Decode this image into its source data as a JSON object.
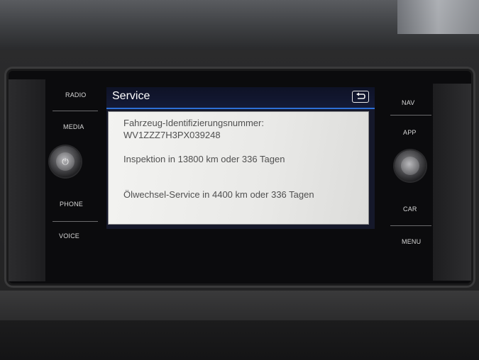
{
  "hardware_buttons": {
    "left": {
      "radio": "RADIO",
      "media": "MEDIA",
      "phone": "PHONE",
      "voice": "VOICE"
    },
    "right": {
      "nav": "NAV",
      "app": "APP",
      "car": "CAR",
      "menu": "MENU"
    }
  },
  "screen": {
    "title": "Service",
    "vin_label": "Fahrzeug-Identifizierungsnummer:",
    "vin_value": "WV1ZZZ7H3PX039248",
    "inspection": "Inspektion in 13800 km oder 336 Tagen",
    "oil_service": "Ölwechsel-Service in 4400 km oder 336 Tagen"
  },
  "icons": {
    "back": "back-arrow-icon",
    "power": "power-icon"
  },
  "colors": {
    "accent_line": "#2d6fd6",
    "header_bg": "#0e1226",
    "panel_bg": "#eeeeec",
    "panel_text": "#505050"
  }
}
